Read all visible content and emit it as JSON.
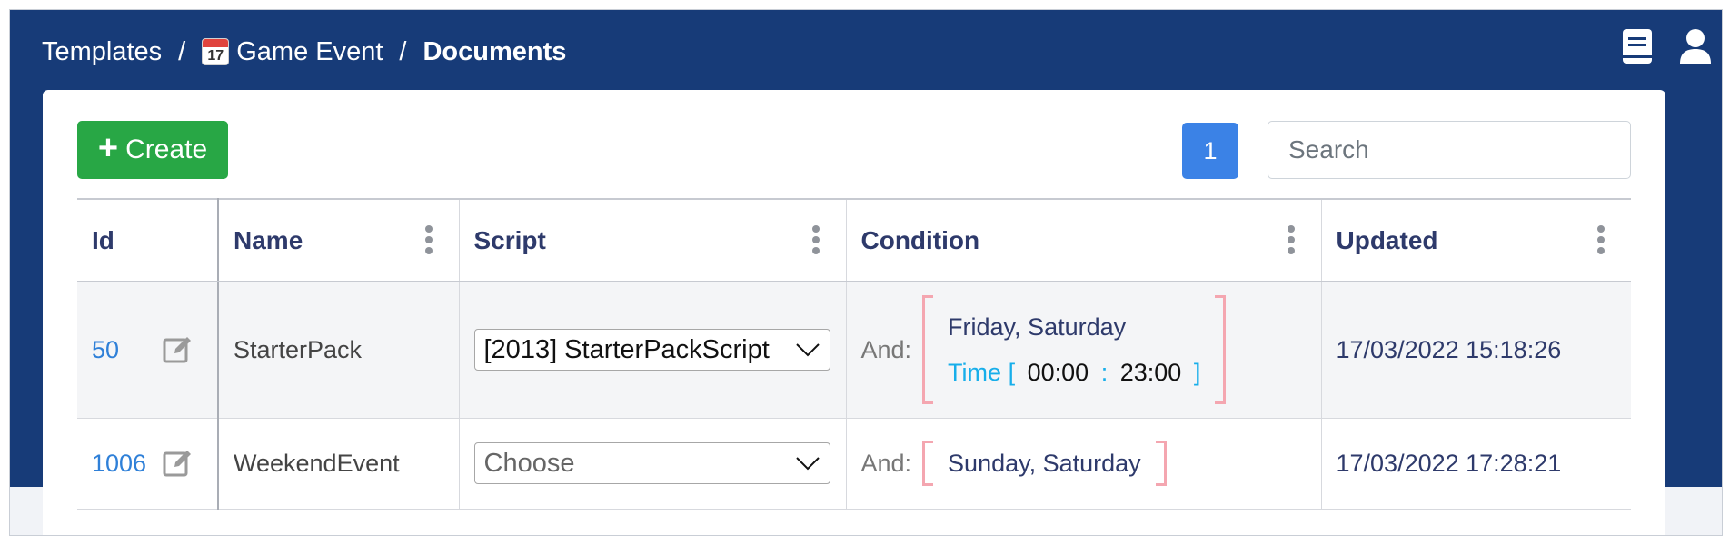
{
  "breadcrumb": {
    "items": [
      "Templates",
      "Game Event",
      "Documents"
    ],
    "calendar_day": "17",
    "separator": "/"
  },
  "toolbar": {
    "create_label": "Create",
    "current_page": "1",
    "search_placeholder": "Search"
  },
  "table": {
    "columns": [
      "Id",
      "Name",
      "Script",
      "Condition",
      "Updated"
    ],
    "rows": [
      {
        "id": "50",
        "name": "StarterPack",
        "script": "[2013] StarterPackScript",
        "condition": {
          "and_label": "And:",
          "days": "Friday, Saturday",
          "time_label": "Time",
          "time_open": "[",
          "time_start": "00:00",
          "time_sep": ":",
          "time_end": "23:00",
          "time_close": "]"
        },
        "updated": "17/03/2022 15:18:26"
      },
      {
        "id": "1006",
        "name": "WeekendEvent",
        "script": "Choose",
        "condition": {
          "and_label": "And:",
          "days": "Sunday, Saturday"
        },
        "updated": "17/03/2022 17:28:21"
      }
    ]
  },
  "colors": {
    "header_bg": "#173b78",
    "create_green": "#28a745",
    "page_blue": "#3b82e6",
    "link_blue": "#2f80d8",
    "bracket_pink": "#f4a6b0",
    "time_cyan": "#17aeea"
  },
  "icons": {
    "top_right": [
      "book-icon",
      "user-icon"
    ],
    "row_edit": "edit-icon",
    "column_menu": "kebab-menu-icon",
    "select_arrow": "chevron-down-icon"
  }
}
